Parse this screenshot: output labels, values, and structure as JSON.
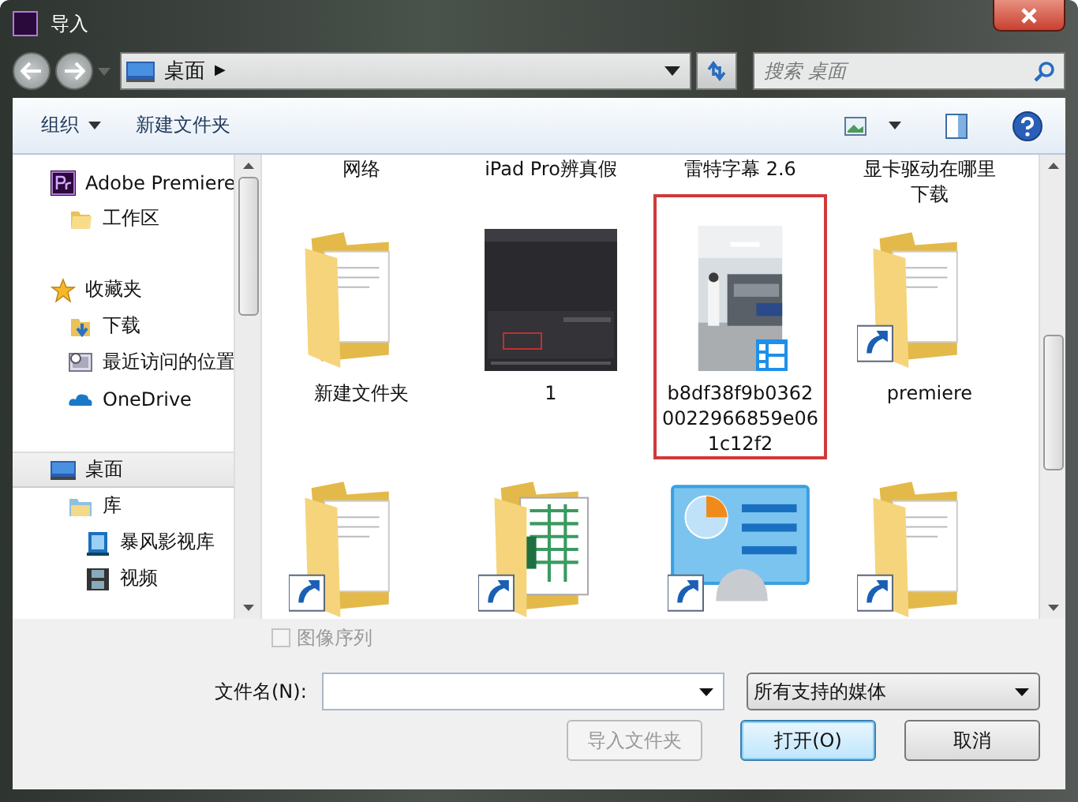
{
  "window": {
    "title": "导入"
  },
  "address": {
    "path": "桌面",
    "separator": "▶"
  },
  "search": {
    "placeholder": "搜索 桌面"
  },
  "toolbar": {
    "organize": "组织",
    "new_folder": "新建文件夹"
  },
  "sidebar": {
    "items": [
      {
        "label": "Adobe Premiere",
        "kind": "premiere",
        "selected": false,
        "children": [
          {
            "label": "工作区",
            "kind": "folder",
            "selected": false
          }
        ]
      },
      {
        "label": "收藏夹",
        "kind": "star",
        "selected": false,
        "children": [
          {
            "label": "下载",
            "kind": "download",
            "selected": false
          },
          {
            "label": "最近访问的位置",
            "kind": "recent",
            "selected": false
          },
          {
            "label": "OneDrive",
            "kind": "cloud",
            "selected": false
          }
        ]
      },
      {
        "label": "桌面",
        "kind": "desktop",
        "selected": true,
        "children": [
          {
            "label": "库",
            "kind": "library",
            "selected": false,
            "children": [
              {
                "label": "暴风影视库",
                "kind": "media",
                "selected": false
              },
              {
                "label": "视频",
                "kind": "film",
                "selected": false
              }
            ]
          }
        ]
      }
    ]
  },
  "files": {
    "cut_labels": [
      "网络",
      "iPad Pro辨真假",
      "雷特字幕 2.6",
      "显卡驱动在哪里下载"
    ],
    "items": [
      {
        "name": "新建文件夹",
        "kind": "folder",
        "shortcut": false,
        "highlighted": false
      },
      {
        "name": "1",
        "kind": "thumbnail",
        "shortcut": false,
        "highlighted": false
      },
      {
        "name": "b8df38f9b0362\n0022966859e06\n1c12f2",
        "kind": "video",
        "shortcut": false,
        "highlighted": true
      },
      {
        "name": "premiere",
        "kind": "folder",
        "shortcut": true,
        "highlighted": false
      },
      {
        "kind": "folder",
        "shortcut": true,
        "highlighted": false
      },
      {
        "kind": "spreadsheet-folder",
        "shortcut": true,
        "highlighted": false
      },
      {
        "kind": "control-panel",
        "shortcut": true,
        "highlighted": false
      },
      {
        "kind": "folder",
        "shortcut": true,
        "highlighted": false
      }
    ]
  },
  "image_sequence": {
    "label": "图像序列",
    "checked": false,
    "disabled": true
  },
  "filename": {
    "label": "文件名(N):"
  },
  "filter": {
    "value": "所有支持的媒体"
  },
  "buttons": [
    {
      "label": "导入文件夹",
      "kind": "secondary",
      "disabled": true
    },
    {
      "label": "打开(O)",
      "kind": "default",
      "disabled": false
    },
    {
      "label": "取消",
      "kind": "secondary",
      "disabled": false
    }
  ]
}
